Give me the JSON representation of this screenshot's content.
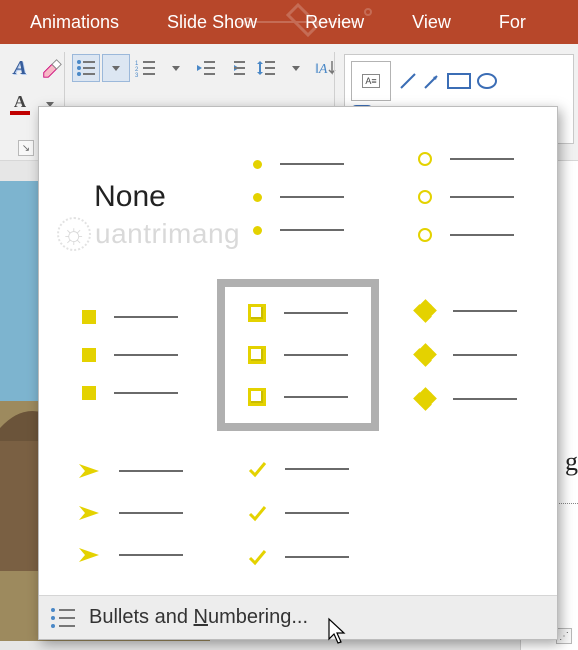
{
  "tabs": {
    "animations": "Animations",
    "slideshow": "Slide Show",
    "review": "Review",
    "view": "View",
    "format": "For"
  },
  "bullets": {
    "none_label": "None",
    "footer_prefix": "Bullets and ",
    "footer_u": "N",
    "footer_suffix": "umbering..."
  },
  "watermark": {
    "text": "uantrimang"
  },
  "slide": {
    "partial_text": "g"
  }
}
